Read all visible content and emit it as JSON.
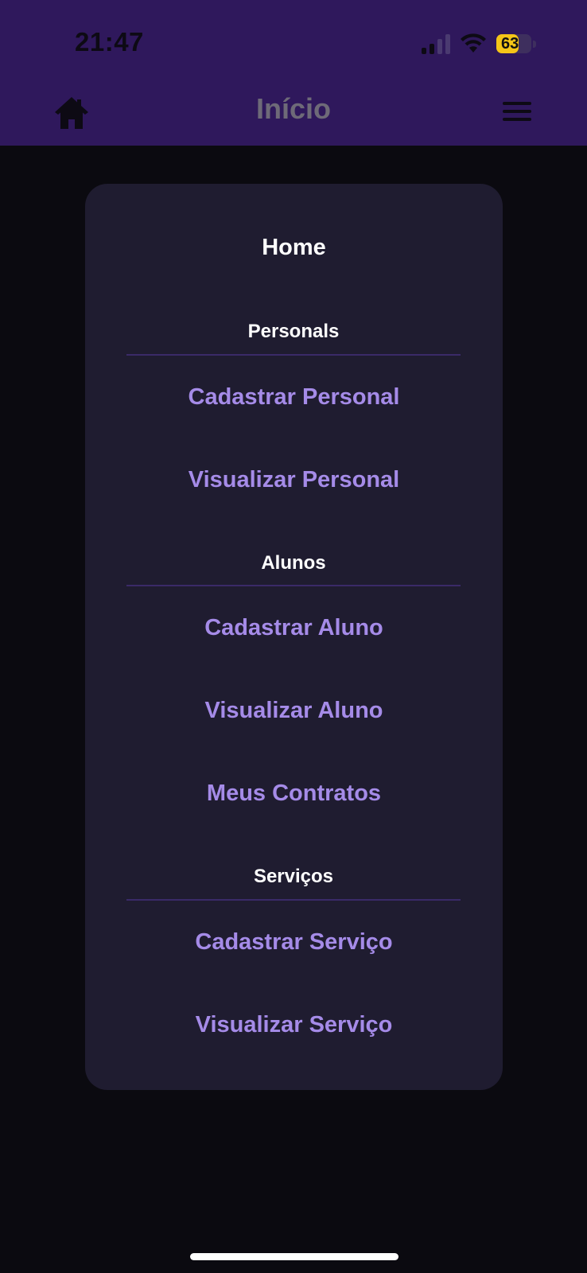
{
  "status_bar": {
    "time": "21:47",
    "battery_level": "63",
    "battery_percent": 63,
    "signal_bars_active": 2,
    "signal_bars_total": 4,
    "wifi_icon": "wifi-icon"
  },
  "nav": {
    "title": "Início",
    "left_icon": "home-icon",
    "right_icon": "hamburger-menu-icon"
  },
  "menu": {
    "title": "Home",
    "sections": [
      {
        "label": "Personals",
        "items": [
          "Cadastrar Personal",
          "Visualizar Personal"
        ]
      },
      {
        "label": "Alunos",
        "items": [
          "Cadastrar Aluno",
          "Visualizar Aluno",
          "Meus Contratos"
        ]
      },
      {
        "label": "Serviços",
        "items": [
          "Cadastrar Serviço",
          "Visualizar Serviço"
        ]
      }
    ]
  },
  "colors": {
    "header_bg": "#2f185c",
    "screen_bg": "#0b0a10",
    "card_bg": "#1f1c30",
    "link": "#a58be8",
    "heading": "#ffffff",
    "divider": "#3a2a68",
    "battery": "#f5c518"
  }
}
